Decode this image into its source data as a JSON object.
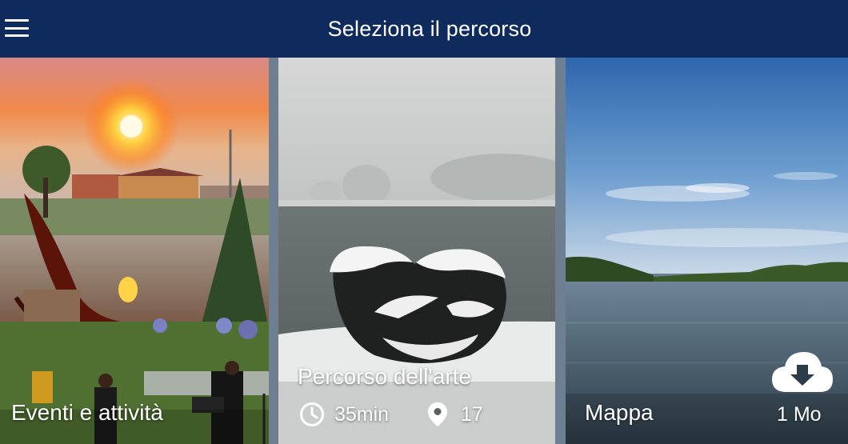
{
  "header": {
    "title": "Seleziona il percorso",
    "menu_icon": "hamburger-menu-icon",
    "background": "#0f2a5c"
  },
  "cards": {
    "events": {
      "label": "Eventi e attività"
    },
    "art": {
      "label": "Percorso dell'arte",
      "duration": "35min",
      "duration_icon": "clock-icon",
      "stops": "17",
      "stops_icon": "map-pin-icon"
    },
    "map": {
      "label": "Mappa",
      "download_icon": "cloud-download-icon",
      "size": "1 Mo"
    }
  }
}
